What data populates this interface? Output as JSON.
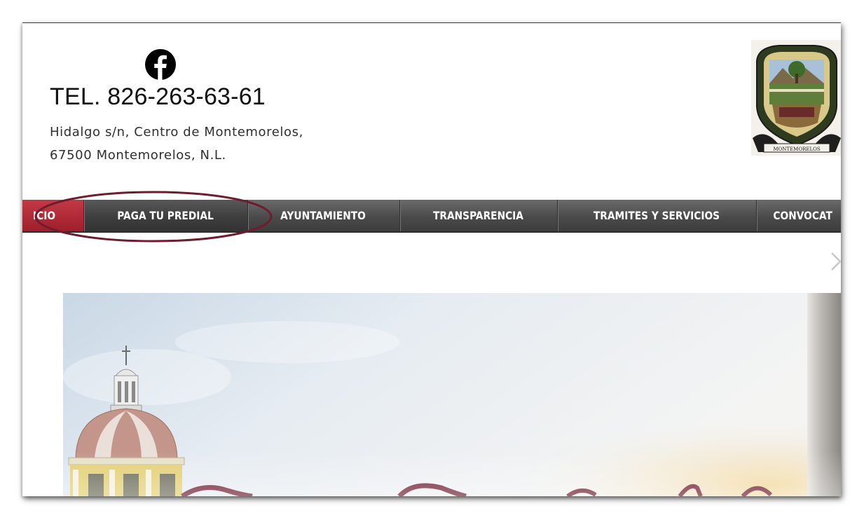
{
  "header": {
    "facebook_icon": "facebook-icon",
    "phone": "TEL. 826-263-63-61",
    "address_line1": "Hidalgo s/n, Centro de Montemorelos,",
    "address_line2": "67500 Montemorelos, N.L.",
    "seal_icon": "municipal-seal-icon"
  },
  "nav": {
    "items": [
      {
        "label": "ICIO",
        "active": true
      },
      {
        "label": "PAGA TU PREDIAL",
        "active": false,
        "highlighted": true
      },
      {
        "label": "AYUNTAMIENTO",
        "active": false
      },
      {
        "label": "TRANSPARENCIA",
        "active": false
      },
      {
        "label": "TRAMITES Y SERVICIOS",
        "active": false
      },
      {
        "label": "CONVOCAT",
        "active": false
      }
    ],
    "active_color": "#b22e3a",
    "bar_color": "#555555",
    "annotation_color": "#6e1c2e"
  },
  "slider": {
    "next_icon": "chevron-right-icon"
  }
}
